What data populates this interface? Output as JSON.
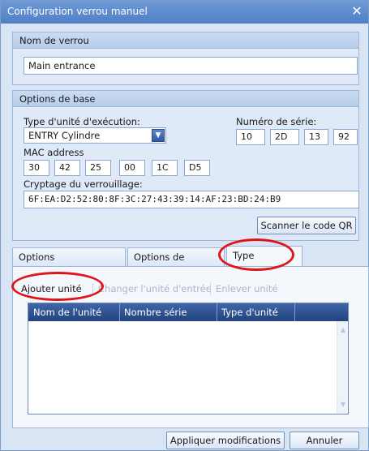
{
  "window": {
    "title": "Configuration verrou manuel",
    "close_glyph": "✕"
  },
  "lock_name_group": {
    "header": "Nom de verrou",
    "value": "Main entrance"
  },
  "basic_options": {
    "header": "Options de base",
    "exec_unit_type_label": "Type d'unité d'exécution:",
    "exec_unit_type_value": "ENTRY Cylindre",
    "serial_label": "Numéro de série:",
    "serial_parts": [
      "10",
      "2D",
      "13",
      "92"
    ],
    "mac_label": "MAC address",
    "mac_parts": [
      "30",
      "42",
      "25",
      "00",
      "1C",
      "D5"
    ],
    "encryption_label": "Cryptage du verrouillage:",
    "encryption_value": "6F:EA:D2:52:80:8F:3C:27:43:39:14:AF:23:BD:24:B9",
    "scan_qr_label": "Scanner le code QR"
  },
  "tabs": [
    {
      "label": "Options additionnelles"
    },
    {
      "label": "Options de réglage"
    },
    {
      "label": "Type d'entrée"
    }
  ],
  "toolbar": {
    "add_unit": "Ajouter unité",
    "change_unit": "Changer l'unité d'entrée",
    "remove_unit": "Enlever unité"
  },
  "grid": {
    "columns": [
      "Nom de l'unité",
      "Nombre série",
      "Type d'unité"
    ],
    "rows": []
  },
  "footer": {
    "apply_label": "Appliquer modifications",
    "cancel_label": "Annuler"
  },
  "colors": {
    "accent": "#4f7fc6",
    "annotation": "#e0141b",
    "grid_header": "#2b4c88"
  }
}
